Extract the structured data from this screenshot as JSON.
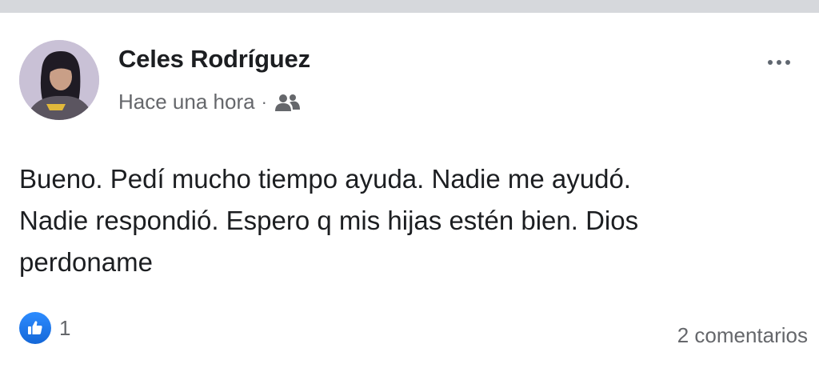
{
  "post": {
    "author": {
      "name": "Celes Rodríguez"
    },
    "timestamp": "Hace una hora",
    "separator": "·",
    "audience_icon": "friends-icon",
    "more_icon": "more-options-icon",
    "body_lines": [
      "Bueno. Pedí mucho tiempo ayuda. Nadie me ayudó.",
      "Nadie respondió. Espero q mis hijas estén bien. Dios",
      "perdoname"
    ],
    "reactions": {
      "icon": "like-icon",
      "count": "1"
    },
    "comments_label": "2 comentarios"
  },
  "colors": {
    "top_strip": "#d6d8dc",
    "text_primary": "#1c1e21",
    "text_secondary": "#65676b",
    "like_blue": "#1877f2"
  }
}
